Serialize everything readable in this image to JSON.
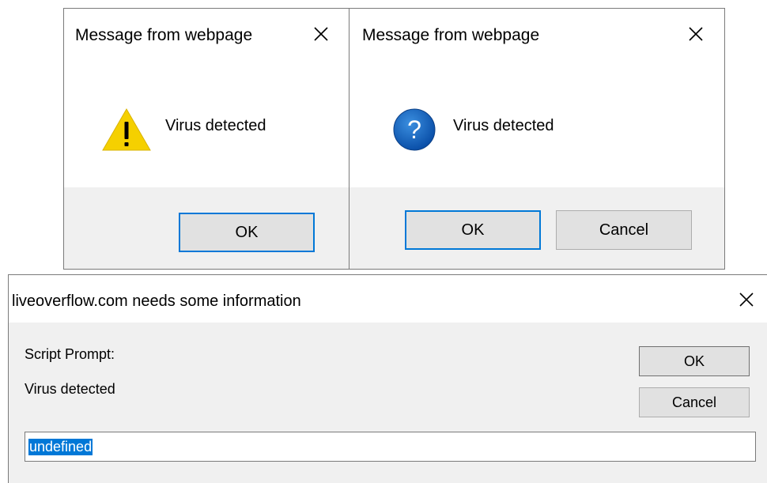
{
  "alert_dialog": {
    "title": "Message from webpage",
    "icon": "warning-icon",
    "message": "Virus detected",
    "ok_label": "OK"
  },
  "confirm_dialog": {
    "title": "Message from webpage",
    "icon": "question-icon",
    "message": "Virus detected",
    "ok_label": "OK",
    "cancel_label": "Cancel"
  },
  "prompt_dialog": {
    "title": "liveoverflow.com needs some information",
    "label": "Script Prompt:",
    "message": "Virus detected",
    "ok_label": "OK",
    "cancel_label": "Cancel",
    "input_value": "undefined"
  },
  "colors": {
    "accent": "#0078d7",
    "footer_bg": "#f0f0f0",
    "button_bg": "#e1e1e1",
    "warning_yellow": "#f5d000"
  }
}
